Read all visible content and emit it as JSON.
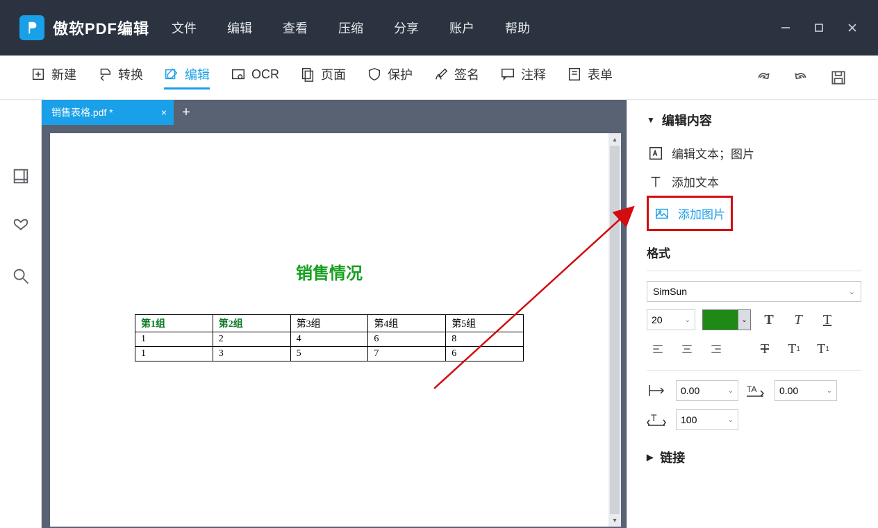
{
  "app": {
    "title": "傲软PDF编辑"
  },
  "menu": [
    "文件",
    "编辑",
    "查看",
    "压缩",
    "分享",
    "账户",
    "帮助"
  ],
  "toolbar": {
    "items": [
      {
        "label": "新建",
        "name": "tool-new"
      },
      {
        "label": "转换",
        "name": "tool-convert"
      },
      {
        "label": "编辑",
        "name": "tool-edit",
        "active": true
      },
      {
        "label": "OCR",
        "name": "tool-ocr"
      },
      {
        "label": "页面",
        "name": "tool-page"
      },
      {
        "label": "保护",
        "name": "tool-protect"
      },
      {
        "label": "签名",
        "name": "tool-sign"
      },
      {
        "label": "注释",
        "name": "tool-annotate"
      },
      {
        "label": "表单",
        "name": "tool-form"
      }
    ]
  },
  "doc": {
    "tab_label": "销售表格.pdf *",
    "page_title": "销售情况",
    "table": {
      "headers": [
        "第1组",
        "第2组",
        "第3组",
        "第4组",
        "第5组"
      ],
      "rows": [
        [
          "1",
          "2",
          "4",
          "6",
          "8"
        ],
        [
          "1",
          "3",
          "5",
          "7",
          "6"
        ]
      ]
    }
  },
  "panel": {
    "edit_content_title": "编辑内容",
    "edit_text_images": "编辑文本；图片",
    "add_text": "添加文本",
    "add_image": "添加图片",
    "format_title": "格式",
    "font": "SimSun",
    "font_size": "20",
    "char_spacing": "0.00",
    "line_spacing": "0.00",
    "scale": "100",
    "link_title": "链接",
    "color": "#1e8a15"
  }
}
